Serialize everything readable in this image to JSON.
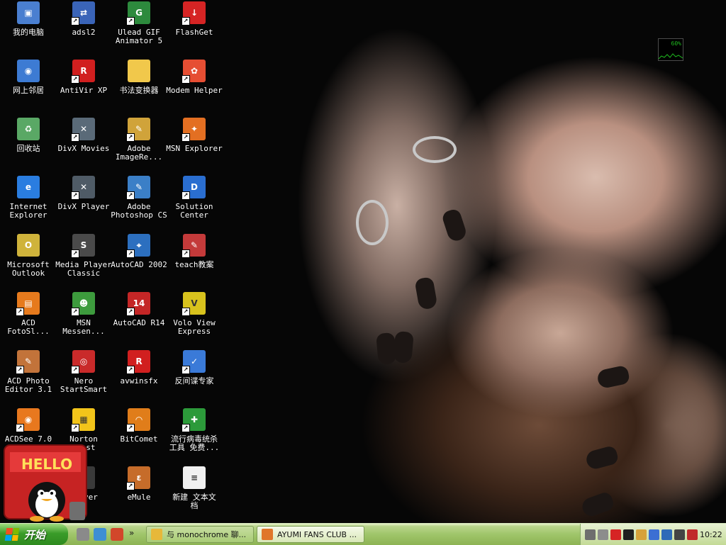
{
  "desktop": {
    "icons": [
      {
        "label": "我的电脑",
        "icon": "my-computer-icon",
        "color": "#4a7fd0",
        "glyph": "▣",
        "shortcut": false
      },
      {
        "label": "adsl2",
        "icon": "network-connection-icon",
        "color": "#3a64b8",
        "glyph": "⇄",
        "shortcut": true
      },
      {
        "label": "Ulead GIF\nAnimator 5",
        "icon": "ulead-gif-animator-icon",
        "color": "#2d8a3d",
        "glyph": "G",
        "shortcut": true
      },
      {
        "label": "FlashGet",
        "icon": "flashget-icon",
        "color": "#d62424",
        "glyph": "↓",
        "shortcut": true
      },
      {
        "label": "网上邻居",
        "icon": "network-places-icon",
        "color": "#3d7bd3",
        "glyph": "◉",
        "shortcut": false
      },
      {
        "label": "AntiVir XP",
        "icon": "antivir-icon",
        "color": "#d11f1f",
        "glyph": "R",
        "shortcut": true
      },
      {
        "label": "书法变换器",
        "icon": "folder-icon",
        "color": "#f1c84b",
        "glyph": "",
        "shortcut": false
      },
      {
        "label": "Modem Helper",
        "icon": "modem-helper-icon",
        "color": "#e64e33",
        "glyph": "✿",
        "shortcut": true
      },
      {
        "label": "回收站",
        "icon": "recycle-bin-icon",
        "color": "#5aa865",
        "glyph": "♻",
        "shortcut": false
      },
      {
        "label": "DivX Movies",
        "icon": "divx-movies-icon",
        "color": "#5a6a78",
        "glyph": "✕",
        "shortcut": true
      },
      {
        "label": "Adobe\nImageRe...",
        "icon": "adobe-imageready-icon",
        "color": "#d0a33a",
        "glyph": "✎",
        "shortcut": true
      },
      {
        "label": "MSN Explorer",
        "icon": "msn-explorer-icon",
        "color": "#e36f22",
        "glyph": "✦",
        "shortcut": true
      },
      {
        "label": "Internet\nExplorer",
        "icon": "internet-explorer-icon",
        "color": "#2a7de0",
        "glyph": "e",
        "shortcut": false
      },
      {
        "label": "DivX Player",
        "icon": "divx-player-icon",
        "color": "#4f5b66",
        "glyph": "✕",
        "shortcut": true
      },
      {
        "label": "Adobe\nPhotoshop CS",
        "icon": "adobe-photoshop-icon",
        "color": "#3b7fc7",
        "glyph": "✎",
        "shortcut": true
      },
      {
        "label": "Solution\nCenter",
        "icon": "dell-solution-center-icon",
        "color": "#2a6ed0",
        "glyph": "D",
        "shortcut": true
      },
      {
        "label": "Microsoft\nOutlook",
        "icon": "outlook-icon",
        "color": "#cfb33b",
        "glyph": "O",
        "shortcut": false
      },
      {
        "label": "Media Player\nClassic",
        "icon": "media-player-classic-icon",
        "color": "#4a4a4a",
        "glyph": "S",
        "shortcut": true
      },
      {
        "label": "AutoCAD 2002",
        "icon": "autocad-2002-icon",
        "color": "#2c6fbf",
        "glyph": "⌖",
        "shortcut": true
      },
      {
        "label": "teach教案",
        "icon": "teach-icon",
        "color": "#c43a3a",
        "glyph": "✎",
        "shortcut": true
      },
      {
        "label": "ACD\nFotoSl...",
        "icon": "acd-fotoslate-icon",
        "color": "#e67a1d",
        "glyph": "▤",
        "shortcut": true
      },
      {
        "label": "MSN\nMessen...",
        "icon": "msn-messenger-icon",
        "color": "#3d9b3d",
        "glyph": "☻",
        "shortcut": true
      },
      {
        "label": "AutoCAD R14",
        "icon": "autocad-r14-icon",
        "color": "#c42626",
        "glyph": "14",
        "shortcut": true
      },
      {
        "label": "Volo View\nExpress",
        "icon": "volo-view-icon",
        "color": "#d8c21d",
        "glyph": "V",
        "shortcut": true
      },
      {
        "label": "ACD Photo\nEditor 3.1",
        "icon": "acd-photo-editor-icon",
        "color": "#c2733a",
        "glyph": "✎",
        "shortcut": true
      },
      {
        "label": "Nero\nStartSmart",
        "icon": "nero-startsmart-icon",
        "color": "#c92a2a",
        "glyph": "◎",
        "shortcut": true
      },
      {
        "label": "avwinsfx",
        "icon": "avwinsfx-icon",
        "color": "#d11f1f",
        "glyph": "R",
        "shortcut": true
      },
      {
        "label": "反间谍专家",
        "icon": "anti-spy-expert-icon",
        "color": "#3a7ad8",
        "glyph": "✓",
        "shortcut": true
      },
      {
        "label": "ACDSee 7.0",
        "icon": "acdsee-icon",
        "color": "#e8781e",
        "glyph": "◉",
        "shortcut": true
      },
      {
        "label": "Norton\nGhost",
        "icon": "norton-icon",
        "color": "#f2c41a",
        "glyph": "▦",
        "shortcut": true
      },
      {
        "label": "BitComet",
        "icon": "bitcomet-icon",
        "color": "#e07d1a",
        "glyph": "◠",
        "shortcut": true
      },
      {
        "label": "流行病毒统杀\n工具 免费...",
        "icon": "virus-kill-tool-icon",
        "color": "#2c9a3a",
        "glyph": "✚",
        "shortcut": true
      },
      {
        "label": "",
        "icon": "hidden-icon",
        "color": "#000000",
        "glyph": "",
        "shortcut": false
      },
      {
        "label": "Player",
        "icon": "player-icon",
        "color": "#3a3a3a",
        "glyph": "▶",
        "shortcut": true
      },
      {
        "label": "eMule",
        "icon": "emule-icon",
        "color": "#c66c2a",
        "glyph": "ε",
        "shortcut": true
      },
      {
        "label": "新建 文本文\n档",
        "icon": "text-document-icon",
        "color": "#f0f0f0",
        "glyph": "≡",
        "shortcut": false
      }
    ]
  },
  "meter": {
    "value_label": "60%",
    "color": "#1eb71e"
  },
  "qq_widget": {
    "sign_text": "HELLO",
    "icon": "qq-penguin-icon"
  },
  "taskbar": {
    "start_label": "开始",
    "quick_launch": [
      {
        "icon": "trash-quicklaunch-icon",
        "color": "#8a8a8a"
      },
      {
        "icon": "msn-quicklaunch-icon",
        "color": "#3d8fd4"
      },
      {
        "icon": "media-quicklaunch-icon",
        "color": "#d2472a"
      }
    ],
    "chevron": "»",
    "tasks": [
      {
        "label": "与 monochrome 聊...",
        "icon": "qq-chat-task-icon",
        "color": "#e7b83a",
        "active": true
      },
      {
        "label": "AYUMI FANS CLUB ...",
        "icon": "firefox-task-icon",
        "color": "#e0762a",
        "active": false
      }
    ],
    "tray": {
      "icons": [
        {
          "icon": "keyboard-tray-icon",
          "color": "#6e6e6e"
        },
        {
          "icon": "expand-tray-icon",
          "color": "#8c8c8c"
        },
        {
          "icon": "flashget-tray-icon",
          "color": "#d62424"
        },
        {
          "icon": "qq-tray-icon",
          "color": "#1f1f1f"
        },
        {
          "icon": "firewall-tray-icon",
          "color": "#d6a23a"
        },
        {
          "icon": "network-tray-icon",
          "color": "#3c6fd3"
        },
        {
          "icon": "security-tray-icon",
          "color": "#2f6bb8"
        },
        {
          "icon": "phone-tray-icon",
          "color": "#444444"
        },
        {
          "icon": "shield-tray-icon",
          "color": "#c02a2a"
        }
      ],
      "clock": "10:22"
    }
  }
}
